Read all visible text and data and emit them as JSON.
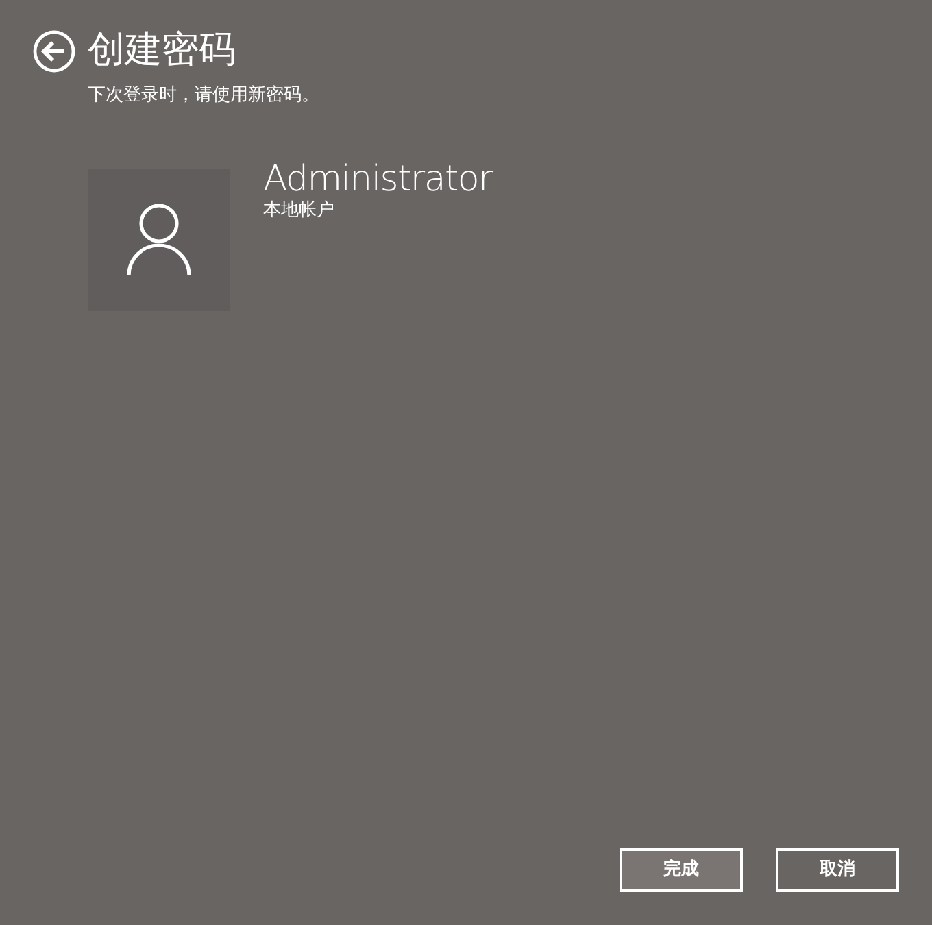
{
  "header": {
    "title": "创建密码",
    "subtitle": "下次登录时，请使用新密码。"
  },
  "account": {
    "name": "Administrator",
    "type": "本地帐户"
  },
  "buttons": [
    {
      "label": "完成",
      "default": true
    },
    {
      "label": "取消",
      "default": false
    }
  ]
}
